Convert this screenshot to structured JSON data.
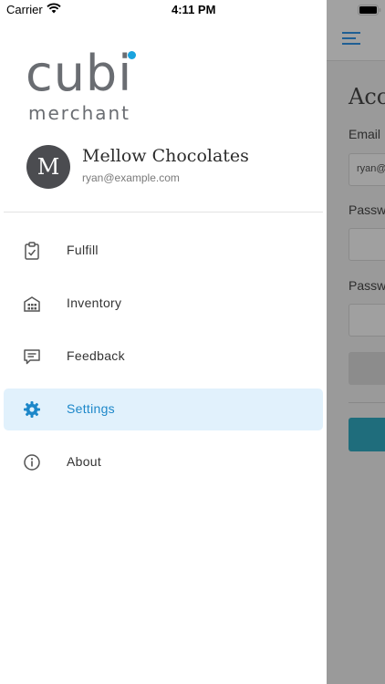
{
  "status_bar": {
    "carrier": "Carrier",
    "time": "4:11 PM"
  },
  "drawer": {
    "logo": {
      "word": "cubi",
      "sub": "merchant"
    },
    "profile": {
      "initial": "M",
      "name": "Mellow Chocolates",
      "email": "ryan@example.com"
    },
    "menu": [
      {
        "label": "Fulfill",
        "icon": "clipboard-check-icon",
        "active": false
      },
      {
        "label": "Inventory",
        "icon": "warehouse-icon",
        "active": false
      },
      {
        "label": "Feedback",
        "icon": "comment-icon",
        "active": false
      },
      {
        "label": "Settings",
        "icon": "gear-icon",
        "active": true
      },
      {
        "label": "About",
        "icon": "info-icon",
        "active": false
      }
    ]
  },
  "background_screen": {
    "title_partial": "Acc",
    "email_label_partial": "Email",
    "email_value_partial": "ryan@",
    "password_label_partial": "Passw",
    "password_confirm_label_partial": "Passw"
  },
  "colors": {
    "accent": "#1c87c9",
    "active_bg": "#e1f1fc",
    "logo_gray": "#6a6d72",
    "logo_dot": "#1aa3de",
    "teal_button": "#1f6d7c"
  }
}
